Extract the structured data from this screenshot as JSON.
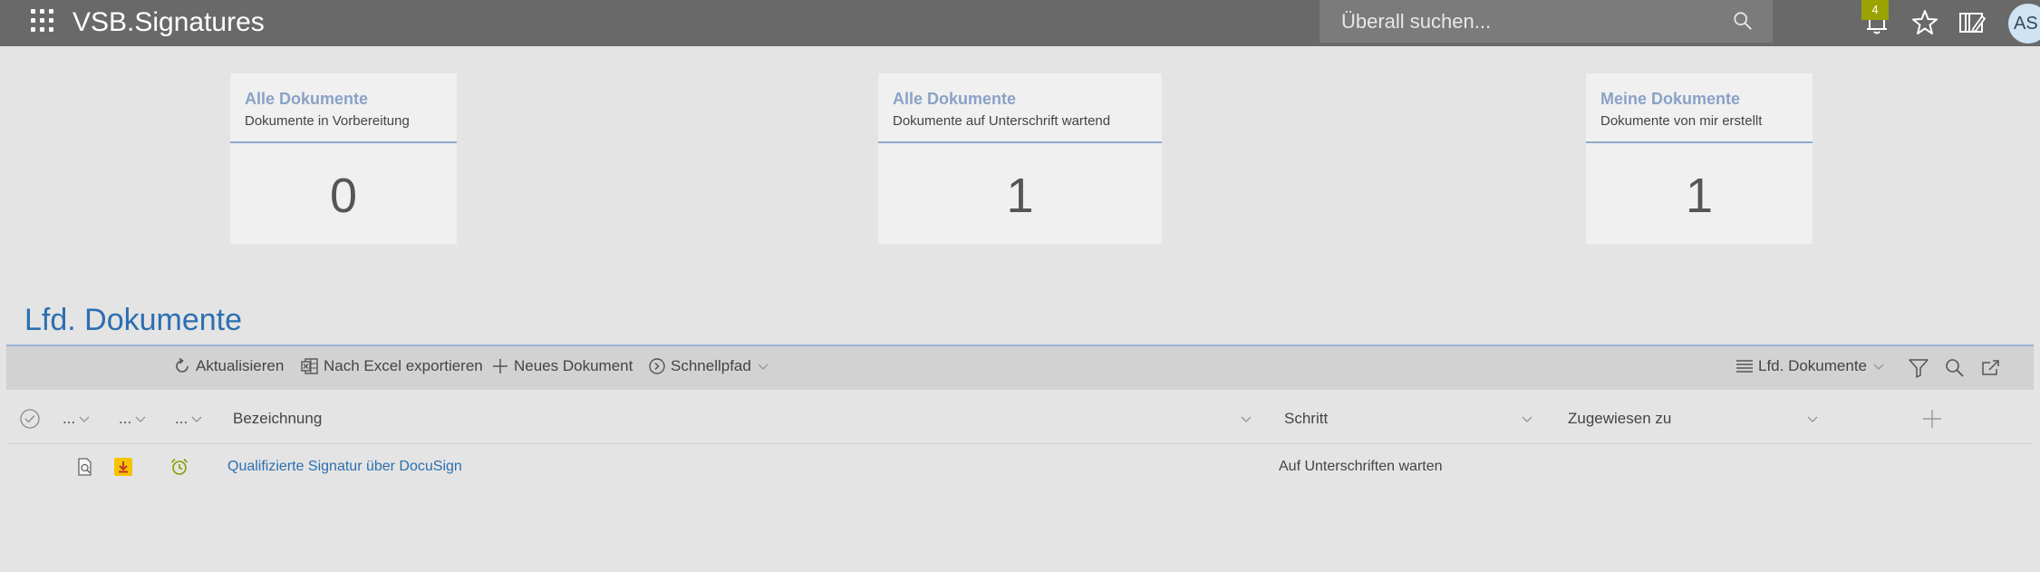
{
  "app": {
    "title": "VSB.Signatures",
    "search_placeholder": "Überall suchen...",
    "notification_count": "4",
    "user_initials": "AS"
  },
  "cards": [
    {
      "title": "Alle Dokumente",
      "subtitle": "Dokumente in Vorbereitung",
      "count": "0"
    },
    {
      "title": "Alle Dokumente",
      "subtitle": "Dokumente auf Unterschrift wartend",
      "count": "1"
    },
    {
      "title": "Meine Dokumente",
      "subtitle": "Dokumente von mir erstellt",
      "count": "1"
    }
  ],
  "list": {
    "title": "Lfd. Dokumente",
    "toolbar": {
      "refresh": "Aktualisieren",
      "export": "Nach Excel exportieren",
      "new": "Neues Dokument",
      "quickpath": "Schnellpfad",
      "view": "Lfd. Dokumente"
    },
    "columns": {
      "c1": "...",
      "c2": "...",
      "c3": "...",
      "name": "Bezeichnung",
      "step": "Schritt",
      "assigned": "Zugewiesen zu"
    },
    "rows": [
      {
        "name": "Qualifizierte Signatur über DocuSign",
        "step": "Auf Unterschriften warten",
        "assigned": ""
      }
    ]
  },
  "colors": {
    "topbar": "#696969",
    "accent_blue": "#2c6fb0",
    "card_title": "#8aa2c7",
    "badge": "#9ba300"
  },
  "icons": [
    "app-launcher-icon",
    "search-icon",
    "bell-icon",
    "star-icon",
    "panel-edit-icon",
    "refresh-icon",
    "excel-icon",
    "plus-icon",
    "quickpath-icon",
    "list-view-icon",
    "filter-icon",
    "magnifier-icon",
    "popout-icon",
    "select-all-icon",
    "doc-preview-icon",
    "download-icon",
    "alarm-clock-icon"
  ]
}
